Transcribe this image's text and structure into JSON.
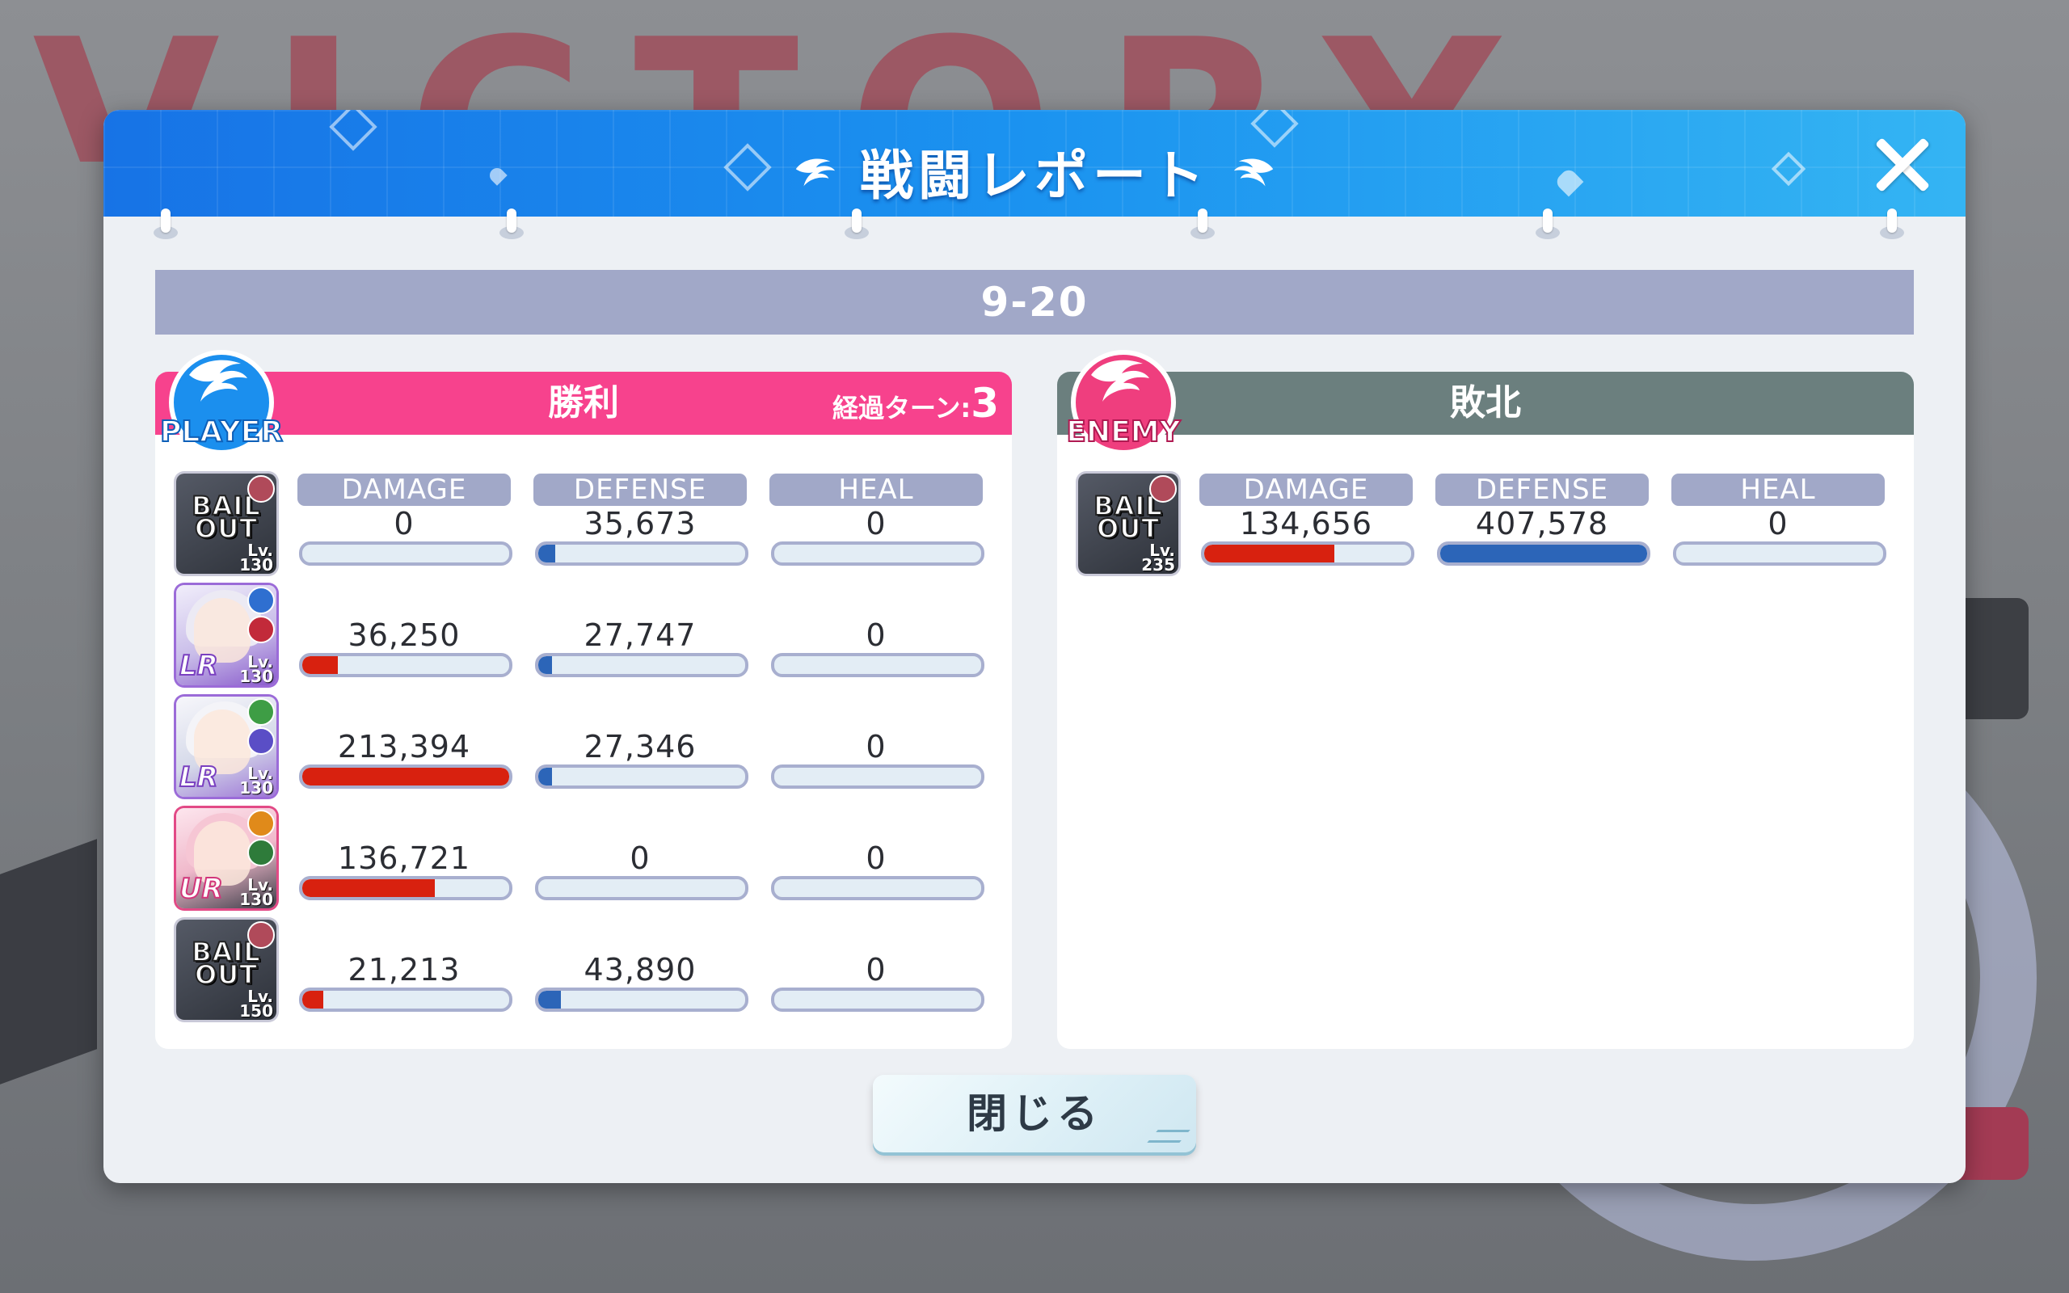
{
  "header": {
    "title": "戦闘レポート"
  },
  "stage": "9-20",
  "player": {
    "badge": "PLAYER",
    "result": "勝利",
    "turns_label": "経過ターン:",
    "turns_value": "3",
    "units": [
      {
        "kind": "bailout",
        "avatar_text": "BAIL OUT",
        "level_label": "Lv.",
        "level": "130",
        "damage": "0",
        "defense": "35,673",
        "heal": "0",
        "damage_pct": 0,
        "defense_pct": 8.1,
        "heal_pct": 0
      },
      {
        "kind": "character",
        "rank": "LR",
        "level_label": "Lv.",
        "level": "130",
        "damage": "36,250",
        "defense": "27,747",
        "heal": "0",
        "damage_pct": 17,
        "defense_pct": 6.8,
        "heal_pct": 0
      },
      {
        "kind": "character",
        "rank": "LR",
        "level_label": "Lv.",
        "level": "130",
        "damage": "213,394",
        "defense": "27,346",
        "heal": "0",
        "damage_pct": 100,
        "defense_pct": 6.7,
        "heal_pct": 0
      },
      {
        "kind": "character",
        "rank": "UR",
        "level_label": "Lv.",
        "level": "130",
        "damage": "136,721",
        "defense": "0",
        "heal": "0",
        "damage_pct": 64,
        "defense_pct": 0,
        "heal_pct": 0
      },
      {
        "kind": "bailout",
        "avatar_text": "BAIL OUT",
        "level_label": "Lv.",
        "level": "150",
        "damage": "21,213",
        "defense": "43,890",
        "heal": "0",
        "damage_pct": 10,
        "defense_pct": 10.8,
        "heal_pct": 0
      }
    ]
  },
  "enemy": {
    "badge": "ENEMY",
    "result": "敗北",
    "units": [
      {
        "kind": "bailout",
        "avatar_text": "BAIL OUT",
        "level_label": "Lv.",
        "level": "235",
        "damage": "134,656",
        "defense": "407,578",
        "heal": "0",
        "damage_pct": 63,
        "defense_pct": 100,
        "heal_pct": 0
      }
    ]
  },
  "labels": {
    "damage": "DAMAGE",
    "defense": "DEFENSE",
    "heal": "HEAL"
  },
  "close_button": "閉じる",
  "colors": {
    "player": "#f7428d",
    "enemy": "#6b7f7e",
    "damage_bar": "#d8210f",
    "defense_bar": "#2c65b8",
    "header": "#1b93f0"
  }
}
